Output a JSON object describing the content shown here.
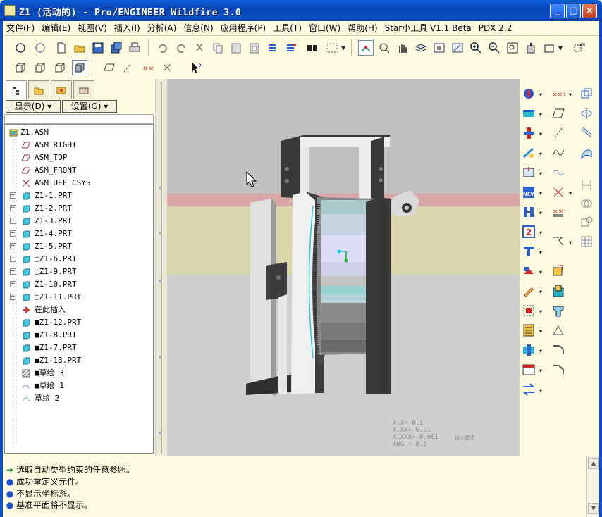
{
  "window": {
    "title": "Z1 (活动的) - Pro/ENGINEER Wildfire 3.0",
    "minimize": "_",
    "maximize": "□",
    "close": "×"
  },
  "menubar": [
    "文件(F)",
    "编辑(E)",
    "视图(V)",
    "插入(I)",
    "分析(A)",
    "信息(N)",
    "应用程序(P)",
    "工具(T)",
    "窗口(W)",
    "帮助(H)",
    "Star小工具 V1.1 Beta",
    "PDX 2.2"
  ],
  "left_panel": {
    "display_button": "显示(D) ▾",
    "settings_button": "设置(G) ▾",
    "tree": [
      {
        "label": "Z1.ASM",
        "icon": "assembly-icon",
        "expander": ""
      },
      {
        "label": "ASM_RIGHT",
        "icon": "datum-plane-icon",
        "expander": ""
      },
      {
        "label": "ASM_TOP",
        "icon": "datum-plane-icon",
        "expander": ""
      },
      {
        "label": "ASM_FRONT",
        "icon": "datum-plane-icon",
        "expander": ""
      },
      {
        "label": "ASM_DEF_CSYS",
        "icon": "csys-icon",
        "expander": ""
      },
      {
        "label": "Z1-1.PRT",
        "icon": "part-icon",
        "expander": "+"
      },
      {
        "label": "Z1-2.PRT",
        "icon": "part-icon",
        "expander": "+"
      },
      {
        "label": "Z1-3.PRT",
        "icon": "part-icon",
        "expander": "+"
      },
      {
        "label": "Z1-4.PRT",
        "icon": "part-icon",
        "expander": "+"
      },
      {
        "label": "Z1-5.PRT",
        "icon": "part-icon",
        "expander": "+"
      },
      {
        "label": "□Z1-6.PRT",
        "icon": "part-icon",
        "expander": "+"
      },
      {
        "label": "□Z1-9.PRT",
        "icon": "part-icon",
        "expander": "+"
      },
      {
        "label": "Z1-10.PRT",
        "icon": "part-icon",
        "expander": "+"
      },
      {
        "label": "□Z1-11.PRT",
        "icon": "part-icon",
        "expander": "+"
      },
      {
        "label": "在此插入",
        "icon": "insert-here-icon",
        "expander": ""
      },
      {
        "label": "■Z1-12.PRT",
        "icon": "part-icon",
        "expander": ""
      },
      {
        "label": "■Z1-8.PRT",
        "icon": "part-icon",
        "expander": ""
      },
      {
        "label": "■Z1-7.PRT",
        "icon": "part-icon",
        "expander": ""
      },
      {
        "label": "■Z1-13.PRT",
        "icon": "part-icon",
        "expander": ""
      },
      {
        "label": "■草绘 3",
        "icon": "sketch-hatch-icon",
        "expander": ""
      },
      {
        "label": "■草绘 1",
        "icon": "sketch-icon",
        "expander": ""
      },
      {
        "label": "草绘 2",
        "icon": "sketch-icon",
        "expander": ""
      }
    ]
  },
  "viewport": {
    "tolerances": "X.X+-0.1\nX.XX+-0.01\nX.XXX+-0.001\nANG +-0.5",
    "input_mode": "输入模式"
  },
  "messages": [
    {
      "type": "prompt",
      "text": "选取自动类型约束的任意参照。"
    },
    {
      "type": "info",
      "text": "成功重定义元件。"
    },
    {
      "type": "info",
      "text": "不显示坐标系。"
    },
    {
      "type": "info",
      "text": "基准平面将不显示。"
    }
  ],
  "colors": {
    "titlebar": "#0a4fc4",
    "panel_bg": "#fffbe0",
    "viewport_bg": "#c9c9c9"
  }
}
